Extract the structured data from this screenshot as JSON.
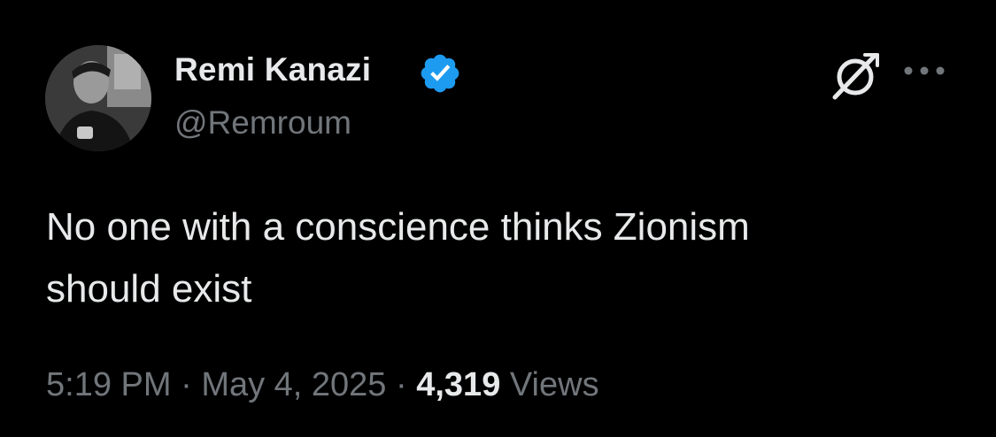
{
  "author": {
    "display_name": "Remi Kanazi",
    "handle": "@Remroum",
    "verified": true,
    "verified_color": "#1d9bf0"
  },
  "tweet": {
    "text": "No one with a conscience thinks Zionism\nshould exist"
  },
  "meta": {
    "time": "5:19 PM",
    "separator": "·",
    "date": "May 4, 2025",
    "views_count": "4,319",
    "views_label": "Views"
  },
  "icons": {
    "verified": "verified-badge-icon",
    "grok": "grok-icon",
    "more": "more-options-icon"
  },
  "colors": {
    "background": "#000000",
    "primary_text": "#e7e9ea",
    "secondary_text": "#71767b",
    "accent": "#1d9bf0"
  }
}
